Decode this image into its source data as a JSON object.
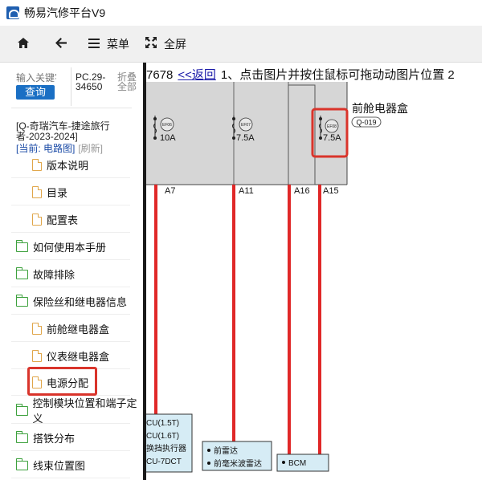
{
  "window": {
    "title": "畅易汽修平台V9"
  },
  "toolbar": {
    "menu_label": "菜单",
    "fullscreen_label": "全屏"
  },
  "search": {
    "placeholder": "输入关键字",
    "button_label": "查询"
  },
  "pc_code": "PC.29-34650",
  "collapse_label": "折叠全部",
  "car": {
    "title": "[Q-奇瑞汽车-捷途旅行者-2023-2024]",
    "current_label": "[当前: 电路图]",
    "refresh_label": "[刷新]"
  },
  "tree": {
    "items": [
      {
        "label": "版本说明",
        "type": "doc"
      },
      {
        "label": "目录",
        "type": "doc"
      },
      {
        "label": "配置表",
        "type": "doc"
      },
      {
        "label": "如何使用本手册",
        "type": "folder"
      },
      {
        "label": "故障排除",
        "type": "folder"
      },
      {
        "label": "保险丝和继电器信息",
        "type": "folder"
      },
      {
        "label": "前舱继电器盒",
        "type": "doc"
      },
      {
        "label": "仪表继电器盒",
        "type": "doc"
      },
      {
        "label": "电源分配",
        "type": "doc",
        "selected": true
      },
      {
        "label": "控制模块位置和端子定义",
        "type": "folder"
      },
      {
        "label": "搭铁分布",
        "type": "folder"
      },
      {
        "label": "线束位置图",
        "type": "folder"
      }
    ]
  },
  "main": {
    "page_no": "7678",
    "back_label": "<<返回",
    "instruction": "1、点击图片并按住鼠标可拖动动图片位置 2"
  },
  "diagram": {
    "box_title": "前舱电器盒",
    "box_code": "Q-019",
    "fuses": [
      {
        "id": "EF06",
        "rating": "10A"
      },
      {
        "id": "EF07",
        "rating": "7.5A"
      },
      {
        "id": "EF08",
        "rating": "7.5A"
      }
    ],
    "pins": [
      "A7",
      "A11",
      "A16",
      "A15"
    ],
    "modules": {
      "left": [
        "CU(1.5T)",
        "CU(1.6T)",
        "换挡执行器",
        "CU-7DCT"
      ],
      "middle": [
        "前雷达",
        "前毫米波雷达"
      ],
      "right": [
        "BCM"
      ]
    },
    "colors": {
      "wire": "#e02828",
      "box_fill": "#d6d6d6",
      "module_fill": "#d6ecf5",
      "highlight": "#d9342b"
    }
  }
}
